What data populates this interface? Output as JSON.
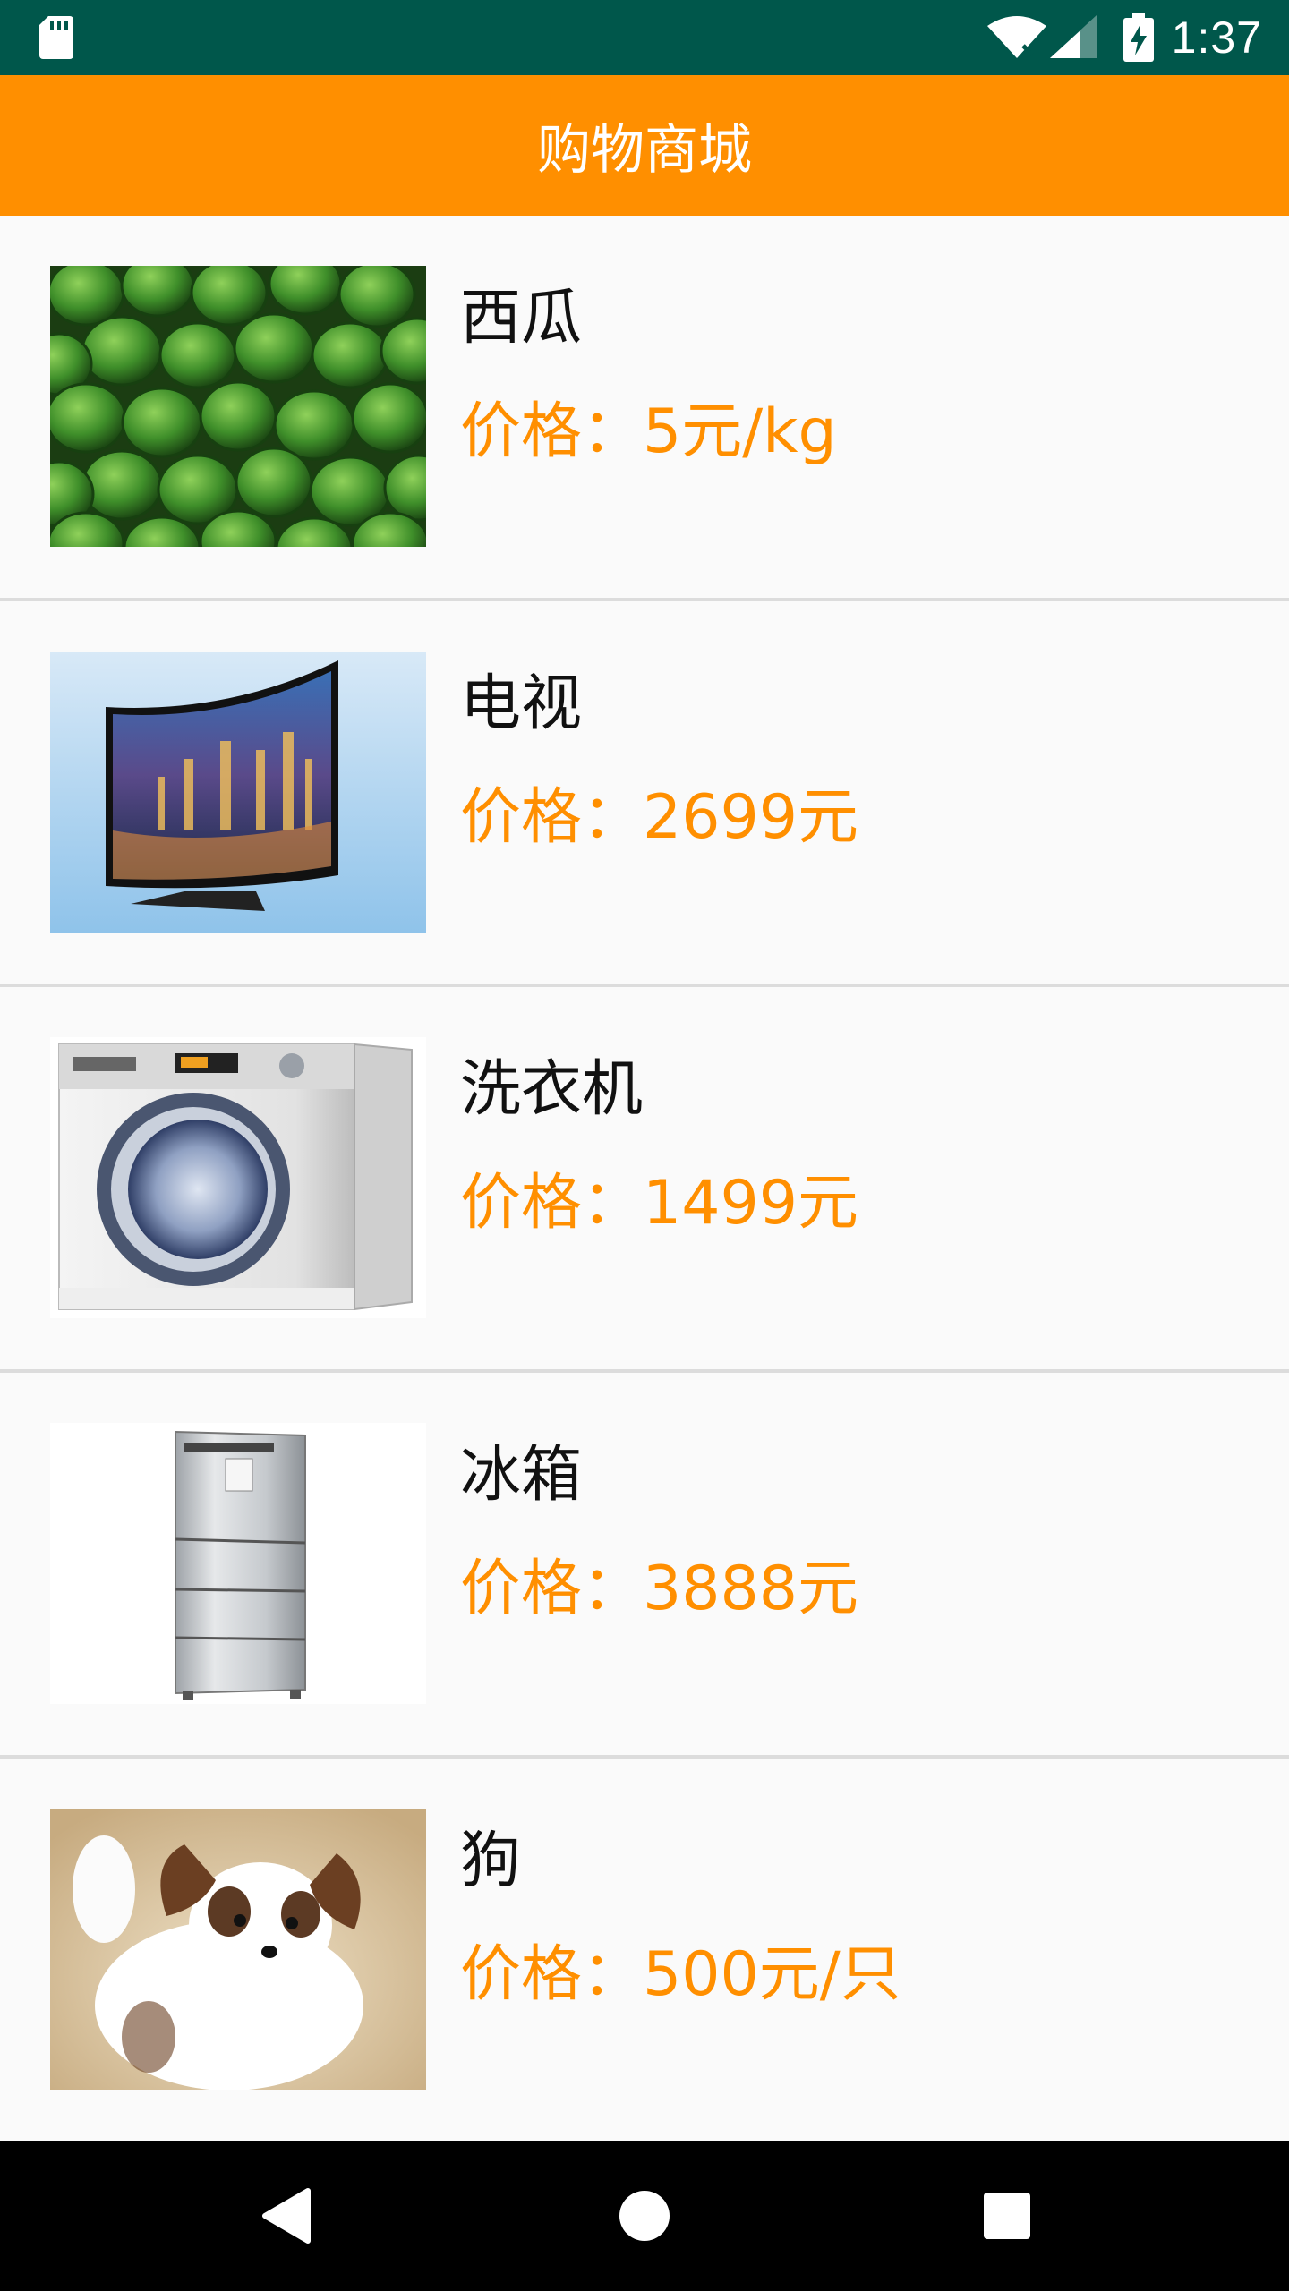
{
  "status_bar": {
    "time": "1:37",
    "icons": [
      "sd-card-icon",
      "wifi-icon",
      "cell-signal-icon",
      "battery-charging-icon"
    ]
  },
  "toolbar": {
    "title": "购物商城"
  },
  "accent_color": "#ff8f00",
  "products": [
    {
      "name": "西瓜",
      "price": "价格：5元/kg",
      "image": "watermelon-image"
    },
    {
      "name": "电视",
      "price": "价格：2699元",
      "image": "tv-image"
    },
    {
      "name": "洗衣机",
      "price": "价格：1499元",
      "image": "washing-machine-image"
    },
    {
      "name": "冰箱",
      "price": "价格：3888元",
      "image": "refrigerator-image"
    },
    {
      "name": "狗",
      "price": "价格：500元/只",
      "image": "dog-image"
    }
  ],
  "nav_bar": {
    "buttons": [
      "back-icon",
      "home-icon",
      "recents-icon"
    ]
  }
}
